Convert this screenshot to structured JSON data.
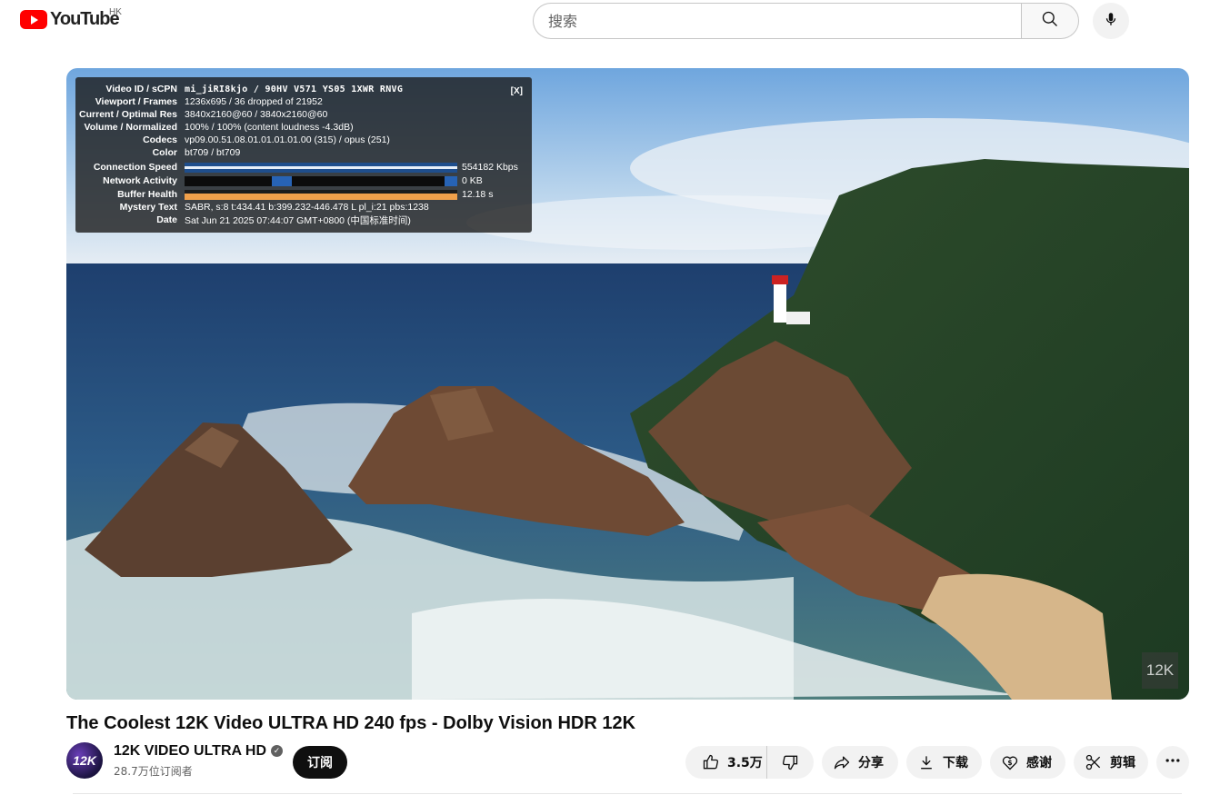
{
  "header": {
    "logo_text": "YouTube",
    "region": "HK",
    "search_placeholder": "搜索",
    "icons": {
      "search": "search-icon",
      "mic": "microphone-icon"
    }
  },
  "player": {
    "watermark": "12K",
    "stats": {
      "close_label": "[X]",
      "rows": [
        {
          "key": "Video ID / sCPN",
          "value": "mi_jiRI8kjo / 90HV V571 YS05 1XWR RNVG"
        },
        {
          "key": "Viewport / Frames",
          "value": "1236x695 / 36 dropped of 21952"
        },
        {
          "key": "Current / Optimal Res",
          "value": "3840x2160@60 / 3840x2160@60"
        },
        {
          "key": "Volume / Normalized",
          "value": "100% / 100% (content loudness -4.3dB)"
        },
        {
          "key": "Codecs",
          "value": "vp09.00.51.08.01.01.01.01.00 (315) / opus (251)"
        },
        {
          "key": "Color",
          "value": "bt709 / bt709"
        },
        {
          "key": "Connection Speed",
          "value": "554182 Kbps"
        },
        {
          "key": "Network Activity",
          "value": "0 KB"
        },
        {
          "key": "Buffer Health",
          "value": "12.18 s"
        },
        {
          "key": "Mystery Text",
          "value": "SABR, s:8 t:434.41 b:399.232-446.478 L pl_i:21 pbs:1238"
        },
        {
          "key": "Date",
          "value": "Sat Jun 21 2025 07:44:07 GMT+0800 (中国标准时间)"
        }
      ]
    }
  },
  "video": {
    "title": "The Coolest 12K Video ULTRA HD 240 fps - Dolby Vision HDR 12K"
  },
  "channel": {
    "avatar_text": "12K",
    "name": "12K VIDEO ULTRA HD",
    "subscribers": "28.7万位订阅者",
    "subscribe_label": "订阅"
  },
  "actions": {
    "like_count": "3.5万",
    "share": "分享",
    "download": "下载",
    "thanks": "感谢",
    "clip": "剪辑"
  },
  "colors": {
    "brand_red": "#ff0000",
    "subscribe_bg": "#0f0f0f",
    "pill_bg": "#f2f2f2"
  }
}
